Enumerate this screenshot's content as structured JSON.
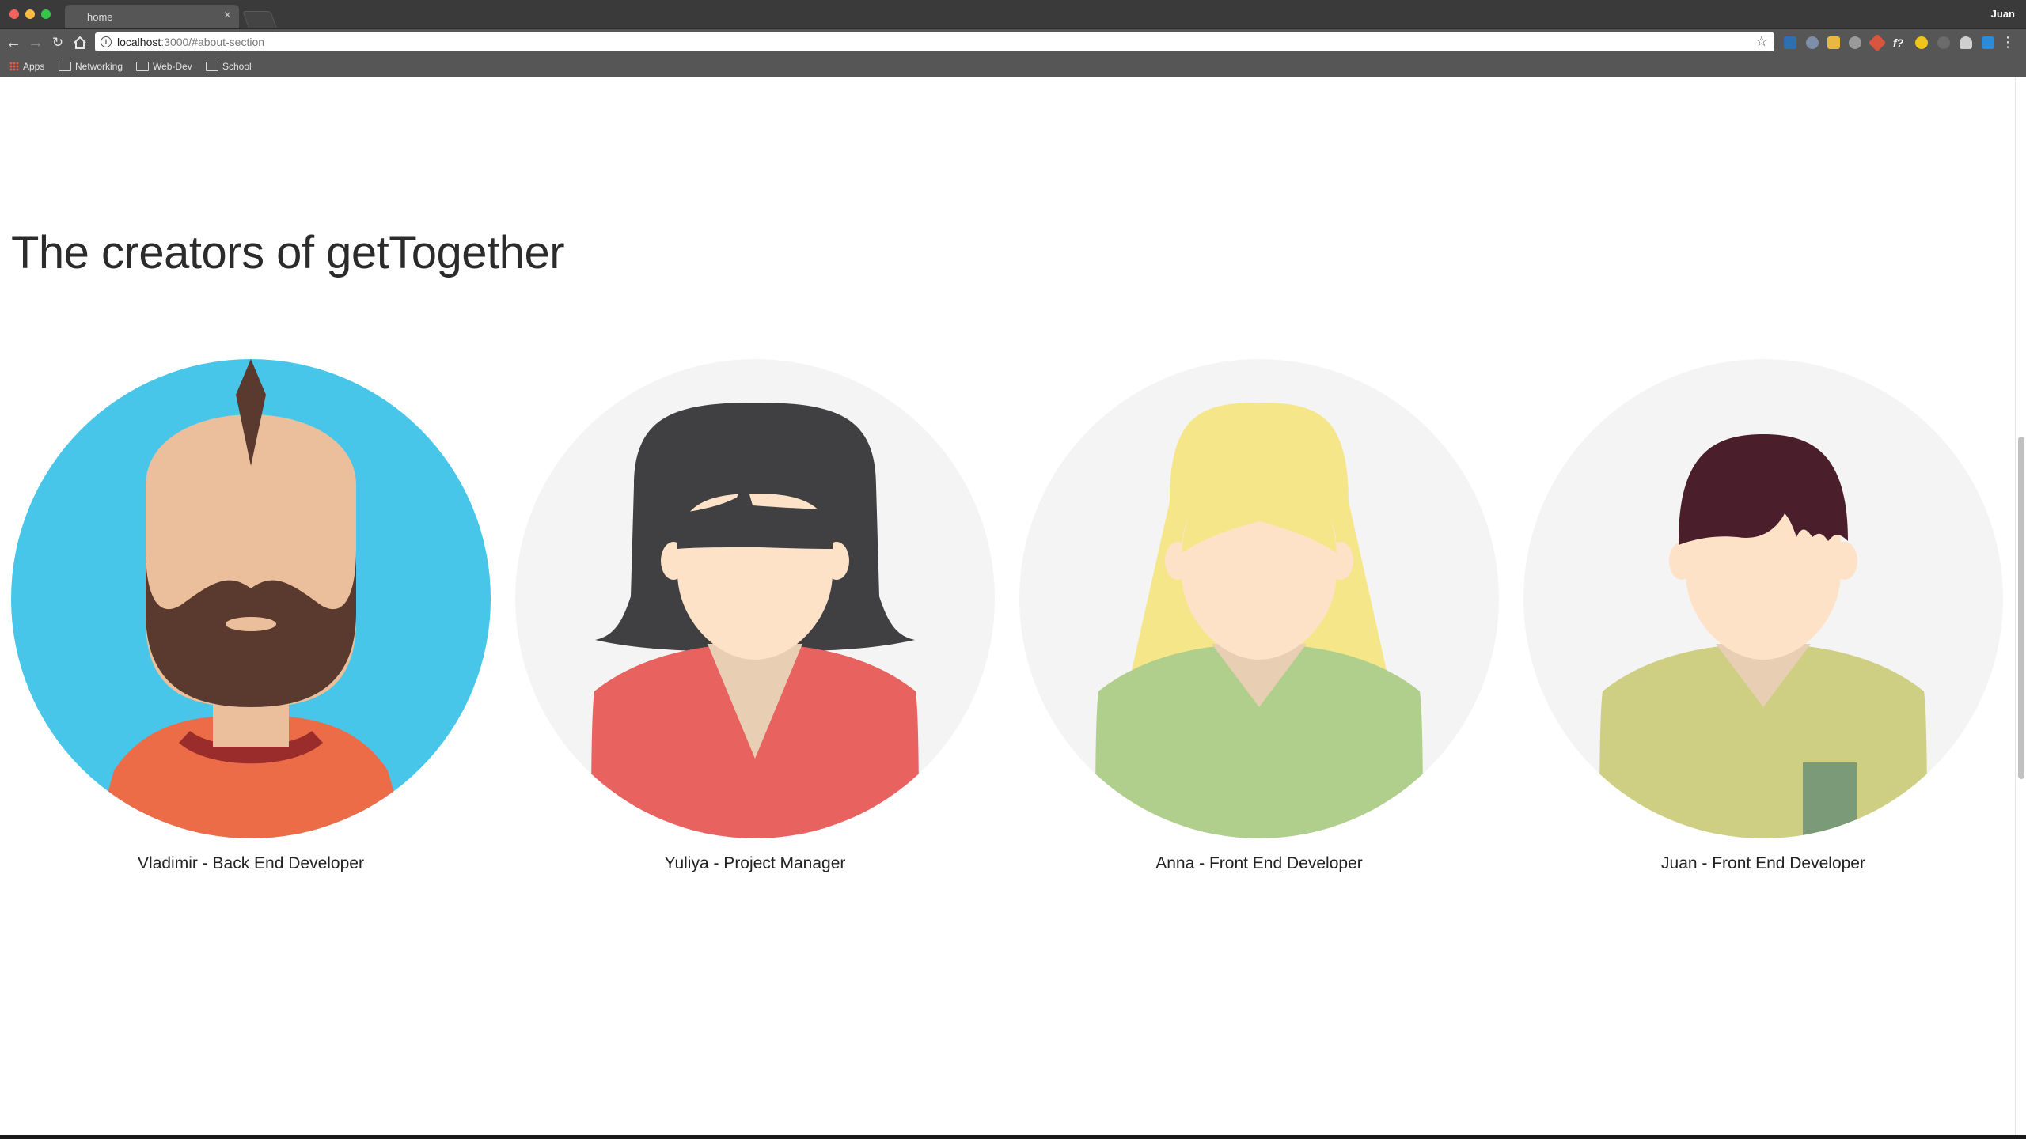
{
  "browser": {
    "tab_title": "home",
    "tab_close": "×",
    "profile_name": "Juan",
    "url_host": "localhost",
    "url_path": ":3000/#about-section",
    "bookmarks": [
      "Apps",
      "Networking",
      "Web-Dev",
      "School"
    ]
  },
  "page": {
    "heading": "The creators of getTogether",
    "team": [
      {
        "caption": "Vladimir - Back End Developer",
        "avatar_background": "#48c6ea"
      },
      {
        "caption": "Yuliya - Project Manager",
        "avatar_background": "#f4f4f4"
      },
      {
        "caption": "Anna - Front End Developer",
        "avatar_background": "#f4f4f4"
      },
      {
        "caption": "Juan - Front End Developer",
        "avatar_background": "#f4f4f4"
      }
    ]
  },
  "colors": {
    "chrome_dark": "#3a3a3a",
    "chrome_toolbar": "#565656",
    "page_background": "#ffffff"
  }
}
